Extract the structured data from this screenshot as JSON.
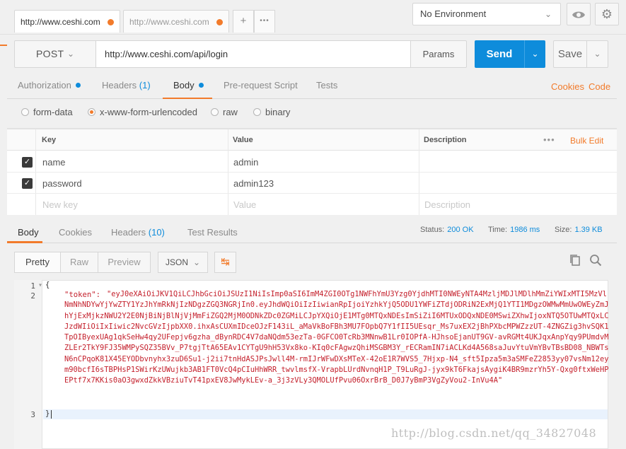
{
  "tabs": [
    {
      "label": "http://www.ceshi.com",
      "active": true
    },
    {
      "label": "http://www.ceshi.com",
      "active": false
    }
  ],
  "tab_controls": {
    "add": "+",
    "more": "•••"
  },
  "environment": {
    "label": "No Environment"
  },
  "request": {
    "method": "POST",
    "url": "http://www.ceshi.com/api/login",
    "params_label": "Params",
    "send_label": "Send",
    "save_label": "Save"
  },
  "request_tabs": {
    "authorization": "Authorization",
    "headers": "Headers",
    "headers_count": "(1)",
    "body": "Body",
    "prerequest": "Pre-request Script",
    "tests": "Tests",
    "cookies": "Cookies",
    "code": "Code"
  },
  "body_types": {
    "form_data": "form-data",
    "urlencoded": "x-www-form-urlencoded",
    "raw": "raw",
    "binary": "binary",
    "selected": "x-www-form-urlencoded"
  },
  "kv_table": {
    "headers": {
      "key": "Key",
      "value": "Value",
      "description": "Description"
    },
    "bulk_edit": "Bulk Edit",
    "rows": [
      {
        "key": "name",
        "value": "admin",
        "checked": true
      },
      {
        "key": "password",
        "value": "admin123",
        "checked": true
      }
    ],
    "placeholder": {
      "key": "New key",
      "value": "Value",
      "description": "Description"
    }
  },
  "response_tabs": {
    "body": "Body",
    "cookies": "Cookies",
    "headers": "Headers",
    "headers_count": "(10)",
    "test_results": "Test Results"
  },
  "response_status": {
    "status_label": "Status:",
    "status_value": "200 OK",
    "time_label": "Time:",
    "time_value": "1986 ms",
    "size_label": "Size:",
    "size_value": "1.39 KB"
  },
  "response_view": {
    "pretty": "Pretty",
    "raw": "Raw",
    "preview": "Preview",
    "format": "JSON"
  },
  "code": {
    "line_numbers": [
      "1",
      "2",
      "3"
    ],
    "open_brace": "{",
    "close_brace": "}",
    "token_key": "\"token\": ",
    "token_value": "\"eyJ0eXAiOiJKV1QiLCJhbGciOiJSUzI1NiIsImp0aSI6ImM4ZGI0OTg1NWFhYmU3Yzg0YjdhMTI0NWEyNTA4MzljMDJlMDlhMmZiYWIxMTI5MzVlNmNhNDYwYjYwZTY1YzJhYmRkNjIzNDgzZGQ3NGRjIn0.eyJhdWQiOiIzIiwianRpIjoiYzhkYjQ5ODU1YWFiZTdjODRiN2ExMjQ1YTI1MDgzOWMwMmUwOWEyZmJhYjExMjkzNWU2Y2E0NjBiNjBlNjVjMmFiZGQ2MjM0ODNkZDc0ZGMiLCJpYXQiOjE1MTg0MTQxNDEsImSiZiI6MTUxODQxNDE0MSwiZXhwIjoxNTQ5OTUwMTQxLCJzdWIiOiIxIiwic2NvcGVzIjpbXX0.ihxAsCUXmIDceOJzF143iL_aMaVkBoFBh3MU7FOpbQ7Y1fII5UEsqr_Ms7uxEX2jBhPXbcMPWZzzUT-4ZNGZig3hvSQK1TpOIByexUAg1qkSeHw4qy2UFepjv6gzha_dBynRDC4V7daNQdm53ezTa-0GFCO0TcRb3MNnwB1Lr0IOPfA-HJhsoEjanUT9GV-avRGMt4UKJqxAnpYqy9PUmdvMZLEr2TkY9FJ35WMPySQZ35BVv_P7tgjTtA65EAv1CYTgU9hH53Vx8ko-KIq0cFAgwzQhiMSGBM3Y_rECRamIN7iACLKd4A568saJuvYtuVmYBvTBsBD08_NBWTsN6nCPqoK81X45EYODbvnyhx3zuD6Su1-j2ii7tnHdASJPsJwll4M-rmIJrWFwDXsMTeX-42oE1R7WVS5_7Hjxp-N4_sft5Ipza5m3aSMFeZ2853yy07vsNm12eym90bcfI6sTBPHsP1SWirKzUWujkb3AB1FT0VcQ4pCIuHhWRR_twvlmsfX-VrapbLUrdNvnqH1P_T9LuRgJ-jyx9kT6FkajsAygiK4BR9mzrYh5Y-Qxg0ftxWeHPEPtf7x7KKis0aO3gwxdZkkVBziuTvT41pxEV8JwMykLEv-a_3j3zVLy3QMOLUfPvu06OxrBrB_D0J7yBmP3VgZyVou2-InVu4A\""
  },
  "watermark": "http://blog.csdn.net/qq_34827048",
  "colors": {
    "accent": "#f27b2b",
    "primary": "#0e8cdb"
  }
}
